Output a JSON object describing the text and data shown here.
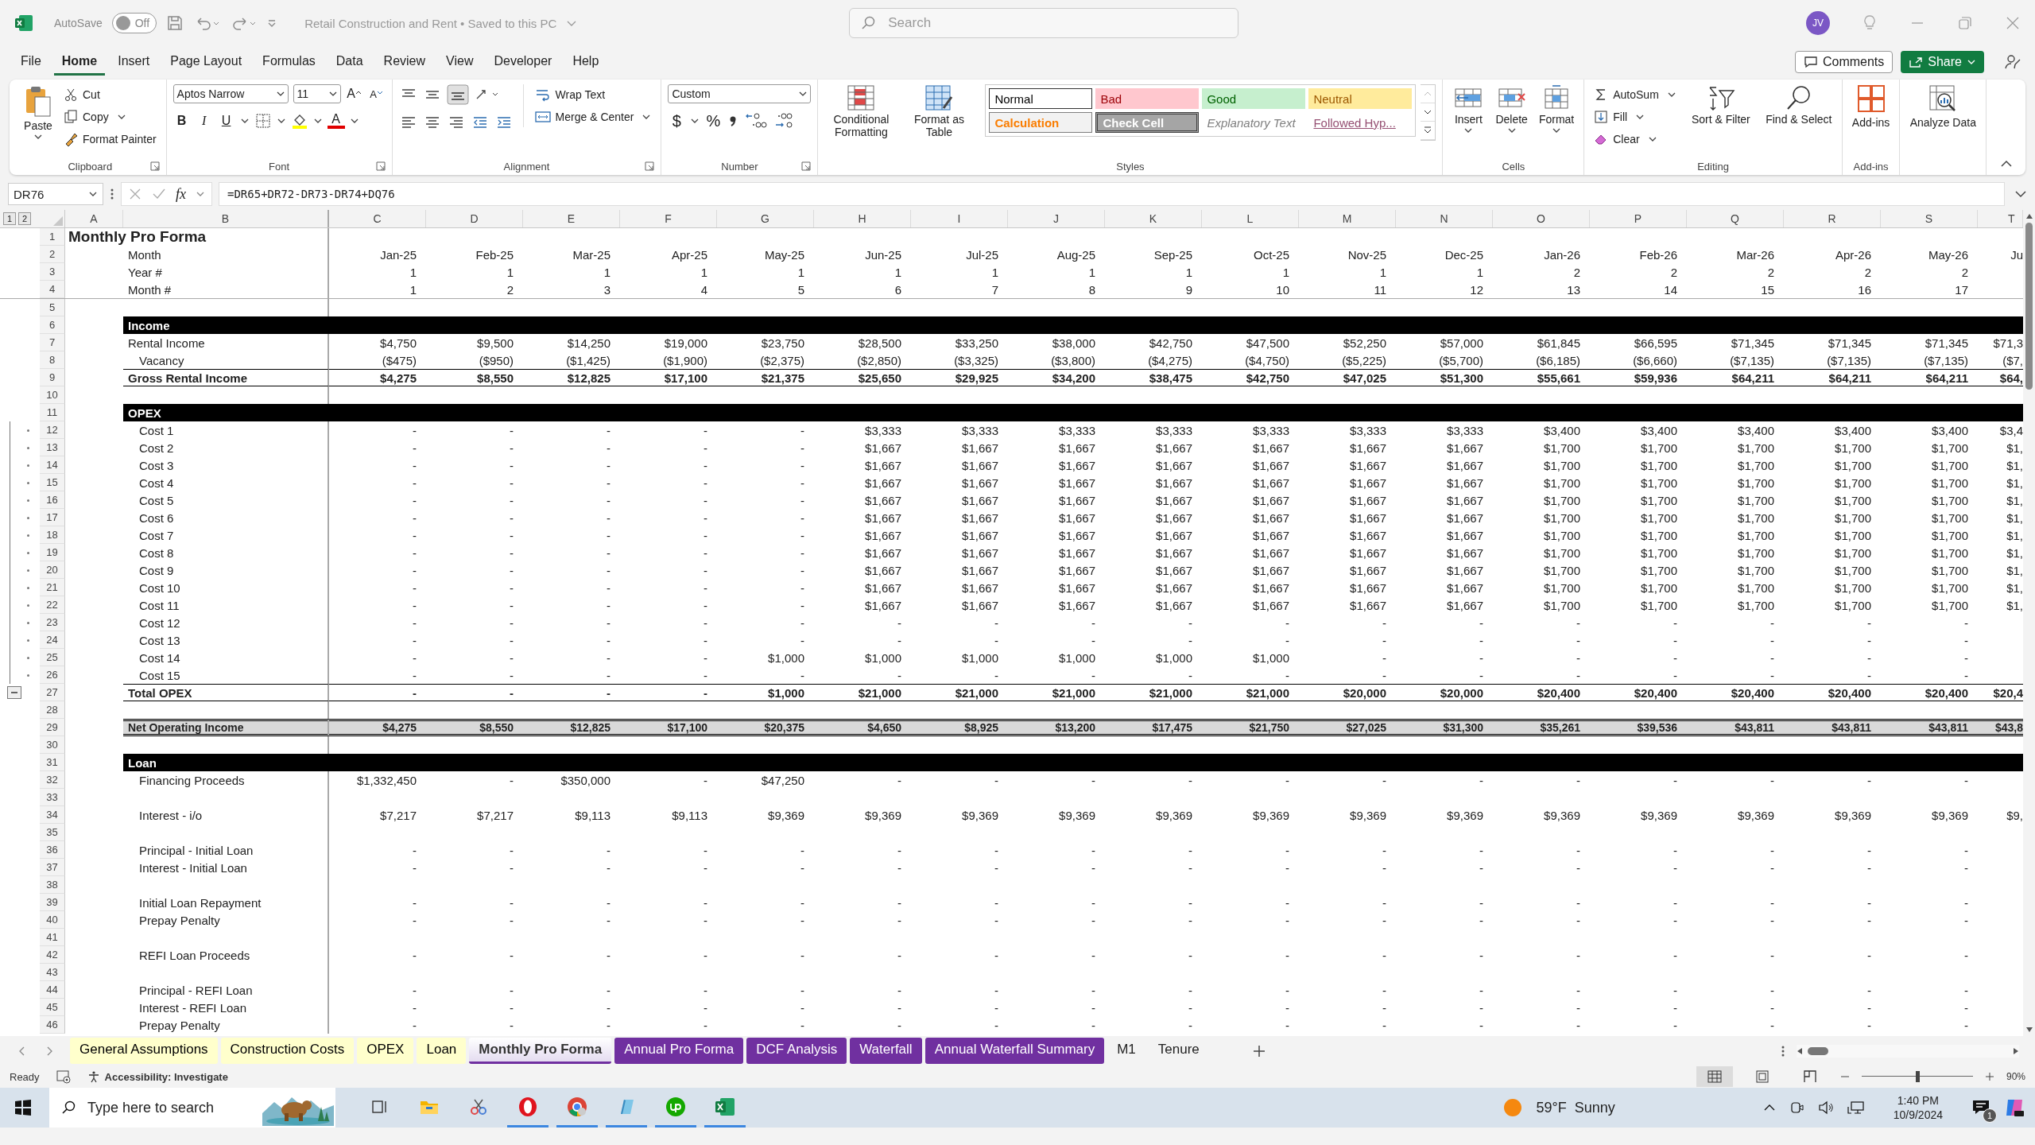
{
  "titlebar": {
    "autosave": "AutoSave",
    "autosave_toggle": {
      "text": "Off",
      "on": false
    },
    "document": "Retail Construction and Rent • Saved to this PC",
    "search": {
      "placeholder": "Search"
    },
    "avatar": "JV"
  },
  "menu": [
    {
      "label": "File",
      "selected": false
    },
    {
      "label": "Home",
      "selected": true
    },
    {
      "label": "Insert",
      "selected": false
    },
    {
      "label": "Page Layout",
      "selected": false
    },
    {
      "label": "Formulas",
      "selected": false
    },
    {
      "label": "Data",
      "selected": false
    },
    {
      "label": "Review",
      "selected": false
    },
    {
      "label": "View",
      "selected": false
    },
    {
      "label": "Developer",
      "selected": false
    },
    {
      "label": "Help",
      "selected": false
    }
  ],
  "menu_right": {
    "comments": "Comments",
    "share": "Share"
  },
  "ribbon": {
    "clipboard": {
      "label": "Clipboard",
      "paste": "Paste",
      "cut": "Cut",
      "copy": "Copy",
      "format_painter": "Format Painter"
    },
    "font": {
      "label": "Font",
      "family": "Aptos Narrow",
      "size": "11",
      "grow": "A",
      "shrink": "A",
      "bold": "B",
      "italic": "I",
      "underline": "U",
      "font_color": "A"
    },
    "alignment": {
      "label": "Alignment",
      "wrap": "Wrap Text",
      "merge": "Merge & Center"
    },
    "number": {
      "label": "Number",
      "format": "Custom",
      "currency": "$",
      "percent": "%"
    },
    "styles": {
      "label": "Styles",
      "conditional": "Conditional Formatting",
      "table": "Format as Table",
      "gallery": [
        {
          "text": "Normal",
          "kind": "normal"
        },
        {
          "text": "Bad",
          "kind": "bad"
        },
        {
          "text": "Good",
          "kind": "good"
        },
        {
          "text": "Neutral",
          "kind": "neutral"
        },
        {
          "text": "Calculation",
          "kind": "calculation"
        },
        {
          "text": "Check Cell",
          "kind": "check"
        },
        {
          "text": "Explanatory Text",
          "kind": "explanatory"
        },
        {
          "text": "Followed Hyp...",
          "kind": "hyperlink"
        }
      ]
    },
    "cells": {
      "label": "Cells",
      "buttons": [
        {
          "text": "Insert",
          "kind": "insert"
        },
        {
          "text": "Delete",
          "kind": "delete"
        },
        {
          "text": "Format",
          "kind": "format"
        }
      ]
    },
    "editing": {
      "label": "Editing",
      "autosum": "AutoSum",
      "fill": "Fill",
      "clear": "Clear",
      "sort": "Sort & Filter",
      "find": "Find & Select"
    },
    "addins": {
      "label": "Add-ins",
      "addins": "Add-ins",
      "analyze": "Analyze Data"
    }
  },
  "formula_bar": {
    "name_box": "DR76",
    "fx": "fx",
    "formula": "=DR65+DR72-DR73-DR74+DQ76"
  },
  "outline_levels": [
    "1",
    "2"
  ],
  "outline_group": {
    "collapse_button": true
  },
  "columns": [
    "A",
    "B",
    "C",
    "D",
    "E",
    "F",
    "G",
    "H",
    "I",
    "J",
    "K",
    "L",
    "M",
    "N",
    "O",
    "P",
    "Q",
    "R",
    "S",
    "T"
  ],
  "frozen_rows": [
    {
      "num": "1",
      "kind": "title",
      "label": "Monthly Pro Forma"
    },
    {
      "num": "2",
      "kind": "item",
      "label": "Month",
      "cells": [
        "Jan-25",
        "Feb-25",
        "Mar-25",
        "Apr-25",
        "May-25",
        "Jun-25",
        "Jul-25",
        "Aug-25",
        "Sep-25",
        "Oct-25",
        "Nov-25",
        "Dec-25",
        "Jan-26",
        "Feb-26",
        "Mar-26",
        "Apr-26",
        "May-26",
        "Ju"
      ]
    },
    {
      "num": "3",
      "kind": "item",
      "label": "Year #",
      "cells": [
        "1",
        "1",
        "1",
        "1",
        "1",
        "1",
        "1",
        "1",
        "1",
        "1",
        "1",
        "1",
        "2",
        "2",
        "2",
        "2",
        "2",
        null
      ]
    },
    {
      "num": "4",
      "kind": "item",
      "label": "Month #",
      "cells": [
        "1",
        "2",
        "3",
        "4",
        "5",
        "6",
        "7",
        "8",
        "9",
        "10",
        "11",
        "12",
        "13",
        "14",
        "15",
        "16",
        "17",
        null
      ]
    }
  ],
  "rows": [
    {
      "num": "5",
      "kind": "blank"
    },
    {
      "num": "6",
      "kind": "band",
      "label": "Income"
    },
    {
      "num": "7",
      "kind": "item",
      "label": "Rental Income",
      "cells": [
        "$4,750",
        "$9,500",
        "$14,250",
        "$19,000",
        "$23,750",
        "$28,500",
        "$33,250",
        "$38,000",
        "$42,750",
        "$47,500",
        "$52,250",
        "$57,000",
        "$61,845",
        "$66,595",
        "$71,345",
        "$71,345",
        "$71,345",
        "$71,3"
      ]
    },
    {
      "num": "8",
      "kind": "sub",
      "label": "Vacancy",
      "cells": [
        "($475)",
        "($950)",
        "($1,425)",
        "($1,900)",
        "($2,375)",
        "($2,850)",
        "($3,325)",
        "($3,800)",
        "($4,275)",
        "($4,750)",
        "($5,225)",
        "($5,700)",
        "($6,185)",
        "($6,660)",
        "($7,135)",
        "($7,135)",
        "($7,135)",
        "($7,"
      ]
    },
    {
      "num": "9",
      "kind": "total",
      "label": "Gross Rental Income",
      "cells": [
        "$4,275",
        "$8,550",
        "$12,825",
        "$17,100",
        "$21,375",
        "$25,650",
        "$29,925",
        "$34,200",
        "$38,475",
        "$42,750",
        "$47,025",
        "$51,300",
        "$55,661",
        "$59,936",
        "$64,211",
        "$64,211",
        "$64,211",
        "$64,"
      ]
    },
    {
      "num": "10",
      "kind": "blank"
    },
    {
      "num": "11",
      "kind": "band",
      "label": "OPEX"
    },
    {
      "num": "12",
      "kind": "sub",
      "grouped": true,
      "label": "Cost 1",
      "cells": [
        "-",
        "-",
        "-",
        "-",
        "-",
        "$3,333",
        "$3,333",
        "$3,333",
        "$3,333",
        "$3,333",
        "$3,333",
        "$3,333",
        "$3,400",
        "$3,400",
        "$3,400",
        "$3,400",
        "$3,400",
        "$3,4"
      ]
    },
    {
      "num": "13",
      "kind": "sub",
      "grouped": true,
      "label": "Cost 2",
      "cells": [
        "-",
        "-",
        "-",
        "-",
        "-",
        "$1,667",
        "$1,667",
        "$1,667",
        "$1,667",
        "$1,667",
        "$1,667",
        "$1,667",
        "$1,700",
        "$1,700",
        "$1,700",
        "$1,700",
        "$1,700",
        "$1,"
      ]
    },
    {
      "num": "14",
      "kind": "sub",
      "grouped": true,
      "label": "Cost 3",
      "cells": [
        "-",
        "-",
        "-",
        "-",
        "-",
        "$1,667",
        "$1,667",
        "$1,667",
        "$1,667",
        "$1,667",
        "$1,667",
        "$1,667",
        "$1,700",
        "$1,700",
        "$1,700",
        "$1,700",
        "$1,700",
        "$1,"
      ]
    },
    {
      "num": "15",
      "kind": "sub",
      "grouped": true,
      "label": "Cost 4",
      "cells": [
        "-",
        "-",
        "-",
        "-",
        "-",
        "$1,667",
        "$1,667",
        "$1,667",
        "$1,667",
        "$1,667",
        "$1,667",
        "$1,667",
        "$1,700",
        "$1,700",
        "$1,700",
        "$1,700",
        "$1,700",
        "$1,"
      ]
    },
    {
      "num": "16",
      "kind": "sub",
      "grouped": true,
      "label": "Cost 5",
      "cells": [
        "-",
        "-",
        "-",
        "-",
        "-",
        "$1,667",
        "$1,667",
        "$1,667",
        "$1,667",
        "$1,667",
        "$1,667",
        "$1,667",
        "$1,700",
        "$1,700",
        "$1,700",
        "$1,700",
        "$1,700",
        "$1,"
      ]
    },
    {
      "num": "17",
      "kind": "sub",
      "grouped": true,
      "label": "Cost 6",
      "cells": [
        "-",
        "-",
        "-",
        "-",
        "-",
        "$1,667",
        "$1,667",
        "$1,667",
        "$1,667",
        "$1,667",
        "$1,667",
        "$1,667",
        "$1,700",
        "$1,700",
        "$1,700",
        "$1,700",
        "$1,700",
        "$1,"
      ]
    },
    {
      "num": "18",
      "kind": "sub",
      "grouped": true,
      "label": "Cost 7",
      "cells": [
        "-",
        "-",
        "-",
        "-",
        "-",
        "$1,667",
        "$1,667",
        "$1,667",
        "$1,667",
        "$1,667",
        "$1,667",
        "$1,667",
        "$1,700",
        "$1,700",
        "$1,700",
        "$1,700",
        "$1,700",
        "$1,"
      ]
    },
    {
      "num": "19",
      "kind": "sub",
      "grouped": true,
      "label": "Cost 8",
      "cells": [
        "-",
        "-",
        "-",
        "-",
        "-",
        "$1,667",
        "$1,667",
        "$1,667",
        "$1,667",
        "$1,667",
        "$1,667",
        "$1,667",
        "$1,700",
        "$1,700",
        "$1,700",
        "$1,700",
        "$1,700",
        "$1,"
      ]
    },
    {
      "num": "20",
      "kind": "sub",
      "grouped": true,
      "label": "Cost 9",
      "cells": [
        "-",
        "-",
        "-",
        "-",
        "-",
        "$1,667",
        "$1,667",
        "$1,667",
        "$1,667",
        "$1,667",
        "$1,667",
        "$1,667",
        "$1,700",
        "$1,700",
        "$1,700",
        "$1,700",
        "$1,700",
        "$1,"
      ]
    },
    {
      "num": "21",
      "kind": "sub",
      "grouped": true,
      "label": "Cost 10",
      "cells": [
        "-",
        "-",
        "-",
        "-",
        "-",
        "$1,667",
        "$1,667",
        "$1,667",
        "$1,667",
        "$1,667",
        "$1,667",
        "$1,667",
        "$1,700",
        "$1,700",
        "$1,700",
        "$1,700",
        "$1,700",
        "$1,"
      ]
    },
    {
      "num": "22",
      "kind": "sub",
      "grouped": true,
      "label": "Cost 11",
      "cells": [
        "-",
        "-",
        "-",
        "-",
        "-",
        "$1,667",
        "$1,667",
        "$1,667",
        "$1,667",
        "$1,667",
        "$1,667",
        "$1,667",
        "$1,700",
        "$1,700",
        "$1,700",
        "$1,700",
        "$1,700",
        "$1,"
      ]
    },
    {
      "num": "23",
      "kind": "sub",
      "grouped": true,
      "label": "Cost 12",
      "cells": [
        "-",
        "-",
        "-",
        "-",
        "-",
        "-",
        "-",
        "-",
        "-",
        "-",
        "-",
        "-",
        "-",
        "-",
        "-",
        "-",
        "-",
        null
      ]
    },
    {
      "num": "24",
      "kind": "sub",
      "grouped": true,
      "label": "Cost 13",
      "cells": [
        "-",
        "-",
        "-",
        "-",
        "-",
        "-",
        "-",
        "-",
        "-",
        "-",
        "-",
        "-",
        "-",
        "-",
        "-",
        "-",
        "-",
        null
      ]
    },
    {
      "num": "25",
      "kind": "sub",
      "grouped": true,
      "label": "Cost 14",
      "cells": [
        "-",
        "-",
        "-",
        "-",
        "$1,000",
        "$1,000",
        "$1,000",
        "$1,000",
        "$1,000",
        "$1,000",
        "-",
        "-",
        "-",
        "-",
        "-",
        "-",
        "-",
        null
      ]
    },
    {
      "num": "26",
      "kind": "sub",
      "grouped": true,
      "label": "Cost 15",
      "cells": [
        "-",
        "-",
        "-",
        "-",
        "-",
        "-",
        "-",
        "-",
        "-",
        "-",
        "-",
        "-",
        "-",
        "-",
        "-",
        "-",
        "-",
        null
      ]
    },
    {
      "num": "27",
      "kind": "total",
      "group_end": true,
      "label": "Total OPEX",
      "cells": [
        "-",
        "-",
        "-",
        "-",
        "$1,000",
        "$21,000",
        "$21,000",
        "$21,000",
        "$21,000",
        "$21,000",
        "$20,000",
        "$20,000",
        "$20,400",
        "$20,400",
        "$20,400",
        "$20,400",
        "$20,400",
        "$20,4"
      ]
    },
    {
      "num": "28",
      "kind": "blank"
    },
    {
      "num": "29",
      "kind": "noi",
      "label": "Net Operating Income",
      "cells": [
        "$4,275",
        "$8,550",
        "$12,825",
        "$17,100",
        "$20,375",
        "$4,650",
        "$8,925",
        "$13,200",
        "$17,475",
        "$21,750",
        "$27,025",
        "$31,300",
        "$35,261",
        "$39,536",
        "$43,811",
        "$43,811",
        "$43,811",
        "$43,8"
      ]
    },
    {
      "num": "30",
      "kind": "blank"
    },
    {
      "num": "31",
      "kind": "band",
      "label": "Loan"
    },
    {
      "num": "32",
      "kind": "sub",
      "label": "Financing Proceeds",
      "cells": [
        "$1,332,450",
        "-",
        "$350,000",
        "-",
        "$47,250",
        "-",
        "-",
        "-",
        "-",
        "-",
        "-",
        "-",
        "-",
        "-",
        "-",
        "-",
        "-",
        null
      ]
    },
    {
      "num": "33",
      "kind": "blank"
    },
    {
      "num": "34",
      "kind": "sub",
      "label": "Interest - i/o",
      "cells": [
        "$7,217",
        "$7,217",
        "$9,113",
        "$9,113",
        "$9,369",
        "$9,369",
        "$9,369",
        "$9,369",
        "$9,369",
        "$9,369",
        "$9,369",
        "$9,369",
        "$9,369",
        "$9,369",
        "$9,369",
        "$9,369",
        "$9,369",
        "$9,"
      ]
    },
    {
      "num": "35",
      "kind": "blank"
    },
    {
      "num": "36",
      "kind": "sub",
      "label": "Principal - Initial Loan",
      "cells": [
        "-",
        "-",
        "-",
        "-",
        "-",
        "-",
        "-",
        "-",
        "-",
        "-",
        "-",
        "-",
        "-",
        "-",
        "-",
        "-",
        "-",
        null
      ]
    },
    {
      "num": "37",
      "kind": "sub",
      "label": "Interest - Initial Loan",
      "cells": [
        "-",
        "-",
        "-",
        "-",
        "-",
        "-",
        "-",
        "-",
        "-",
        "-",
        "-",
        "-",
        "-",
        "-",
        "-",
        "-",
        "-",
        null
      ]
    },
    {
      "num": "38",
      "kind": "blank"
    },
    {
      "num": "39",
      "kind": "sub",
      "label": "Initial Loan Repayment",
      "cells": [
        "-",
        "-",
        "-",
        "-",
        "-",
        "-",
        "-",
        "-",
        "-",
        "-",
        "-",
        "-",
        "-",
        "-",
        "-",
        "-",
        "-",
        null
      ]
    },
    {
      "num": "40",
      "kind": "sub",
      "label": "Prepay Penalty",
      "cells": [
        "-",
        "-",
        "-",
        "-",
        "-",
        "-",
        "-",
        "-",
        "-",
        "-",
        "-",
        "-",
        "-",
        "-",
        "-",
        "-",
        "-",
        null
      ]
    },
    {
      "num": "41",
      "kind": "blank"
    },
    {
      "num": "42",
      "kind": "sub",
      "label": "REFI Loan Proceeds",
      "cells": [
        "-",
        "-",
        "-",
        "-",
        "-",
        "-",
        "-",
        "-",
        "-",
        "-",
        "-",
        "-",
        "-",
        "-",
        "-",
        "-",
        "-",
        null
      ]
    },
    {
      "num": "43",
      "kind": "blank"
    },
    {
      "num": "44",
      "kind": "sub",
      "label": "Principal - REFI Loan",
      "cells": [
        "-",
        "-",
        "-",
        "-",
        "-",
        "-",
        "-",
        "-",
        "-",
        "-",
        "-",
        "-",
        "-",
        "-",
        "-",
        "-",
        "-",
        null
      ]
    },
    {
      "num": "45",
      "kind": "sub",
      "label": "Interest - REFI Loan",
      "cells": [
        "-",
        "-",
        "-",
        "-",
        "-",
        "-",
        "-",
        "-",
        "-",
        "-",
        "-",
        "-",
        "-",
        "-",
        "-",
        "-",
        "-",
        null
      ]
    },
    {
      "num": "46",
      "kind": "sub",
      "label": "Prepay Penalty",
      "cells": [
        "-",
        "-",
        "-",
        "-",
        "-",
        "-",
        "-",
        "-",
        "-",
        "-",
        "-",
        "-",
        "-",
        "-",
        "-",
        "-",
        "-",
        null
      ]
    }
  ],
  "sheet_tabs": [
    {
      "label": "General Assumptions",
      "color": "#ffffcc",
      "selected": false
    },
    {
      "label": "Construction Costs",
      "color": "#ffffcc",
      "selected": false
    },
    {
      "label": "OPEX",
      "color": "#ffffcc",
      "selected": false
    },
    {
      "label": "Loan",
      "color": "#ffffcc",
      "selected": false
    },
    {
      "label": "Monthly Pro Forma",
      "color": "#7030a0",
      "selected": true
    },
    {
      "label": "Annual Pro Forma",
      "color": "#7030a0",
      "selected": false
    },
    {
      "label": "DCF Analysis",
      "color": "#7030a0",
      "selected": false
    },
    {
      "label": "Waterfall",
      "color": "#7030a0",
      "selected": false
    },
    {
      "label": "Annual Waterfall Summary",
      "color": "#7030a0",
      "selected": false
    },
    {
      "label": "M1",
      "selected": false
    },
    {
      "label": "Tenure",
      "selected": false
    }
  ],
  "status_bar": {
    "ready": "Ready",
    "accessibility": "Accessibility: Investigate",
    "views": [
      {
        "kind": "normal",
        "selected": true
      },
      {
        "kind": "layout",
        "selected": false
      },
      {
        "kind": "pagebreak",
        "selected": false
      }
    ],
    "zoom": {
      "level": 0.5,
      "reading": "90%"
    }
  },
  "taskbar": {
    "search": {
      "placeholder": "Type here to search"
    },
    "apps": [
      {
        "kind": "taskview",
        "running": false
      },
      {
        "kind": "explorer",
        "running": false
      },
      {
        "kind": "snip",
        "running": false
      },
      {
        "kind": "opera",
        "running": true
      },
      {
        "kind": "chrome",
        "running": true
      },
      {
        "kind": "notepad",
        "running": true
      },
      {
        "kind": "upwork",
        "running": true
      },
      {
        "kind": "excel",
        "running": true
      }
    ],
    "weather": "59°F  Sunny",
    "time": "1:40 PM",
    "date": "10/9/2024",
    "notifications": "1"
  }
}
